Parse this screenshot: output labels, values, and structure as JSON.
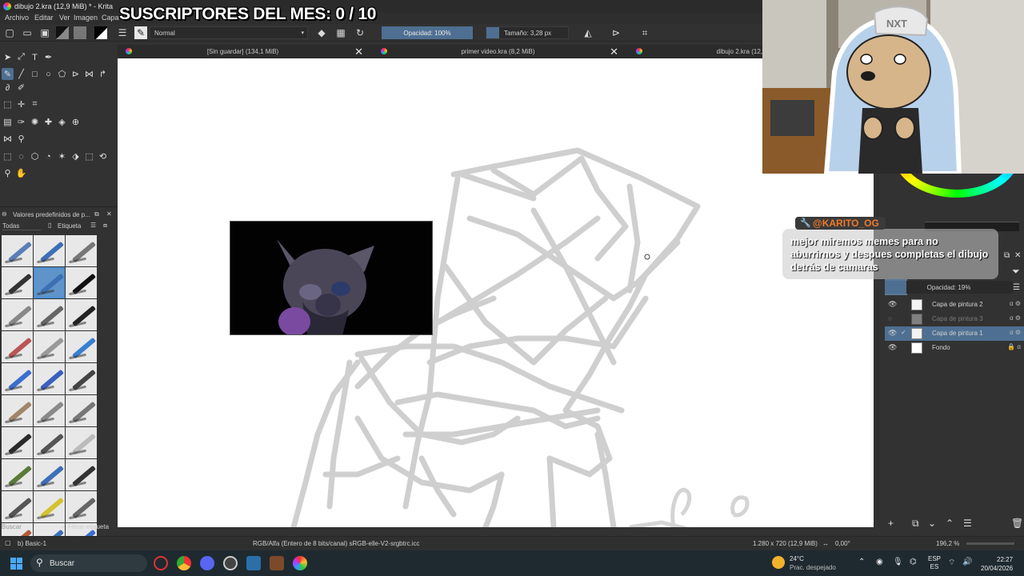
{
  "window": {
    "title": "dibujo 2.kra (12,9 MiB) * - Krita"
  },
  "menu": [
    "Archivo",
    "Editar",
    "Ver",
    "Imagen",
    "Capa"
  ],
  "overlay": {
    "subscriber_counter": "SUSCRIPTORES DEL MES: 0 / 10"
  },
  "toolbar": {
    "blend_mode": "Normal",
    "opacity": "Opacidad: 100%",
    "size": "Tamaño: 3,28 px"
  },
  "tabs": [
    {
      "label": "[Sin guardar]  (134,1 MiB)"
    },
    {
      "label": "primer video.kra (8,2 MiB)"
    },
    {
      "label": "dibujo 2.kra (12,"
    }
  ],
  "presets_docker": {
    "title": "Valores predefinidos de p...",
    "filter": "Todas",
    "tag": "Etiqueta",
    "search_placeholder": "Buscar",
    "filter_tag_label": "Filtrar etiqueta"
  },
  "chat": {
    "username": "@KARITO_OG",
    "message": "mejor miremos memes para no aburrirnos y despues completas el dibujo detrás de camaras"
  },
  "layers": {
    "opacity": "Opacidad:  19%",
    "items": [
      {
        "name": "Capa de pintura 2",
        "visible": true
      },
      {
        "name": "Capa de pintura 3",
        "visible": false
      },
      {
        "name": "Capa de pintura 1",
        "visible": true,
        "active": true
      },
      {
        "name": "Fondo",
        "visible": true,
        "locked": true
      }
    ]
  },
  "status": {
    "preset": "b) Basic-1",
    "color_space": "RGB/Alfa (Entero de 8 bits/canal)  sRGB-elle-V2-srgbtrc.icc",
    "dimensions": "1.280 x 720 (12,9 MiB)",
    "rotation": "0,00°",
    "zoom": "196,2 %"
  },
  "taskbar": {
    "search": "Buscar",
    "weather_temp": "24°C",
    "weather_desc": "Prac. despejado",
    "lang_top": "ESP",
    "lang_bottom": "ES",
    "time": "22:27",
    "date": "20/04/2026"
  },
  "colors": {
    "accent": "#4e6f91",
    "chat_username": "#f07a2a",
    "sketch_stroke": "#c8c8c8"
  }
}
